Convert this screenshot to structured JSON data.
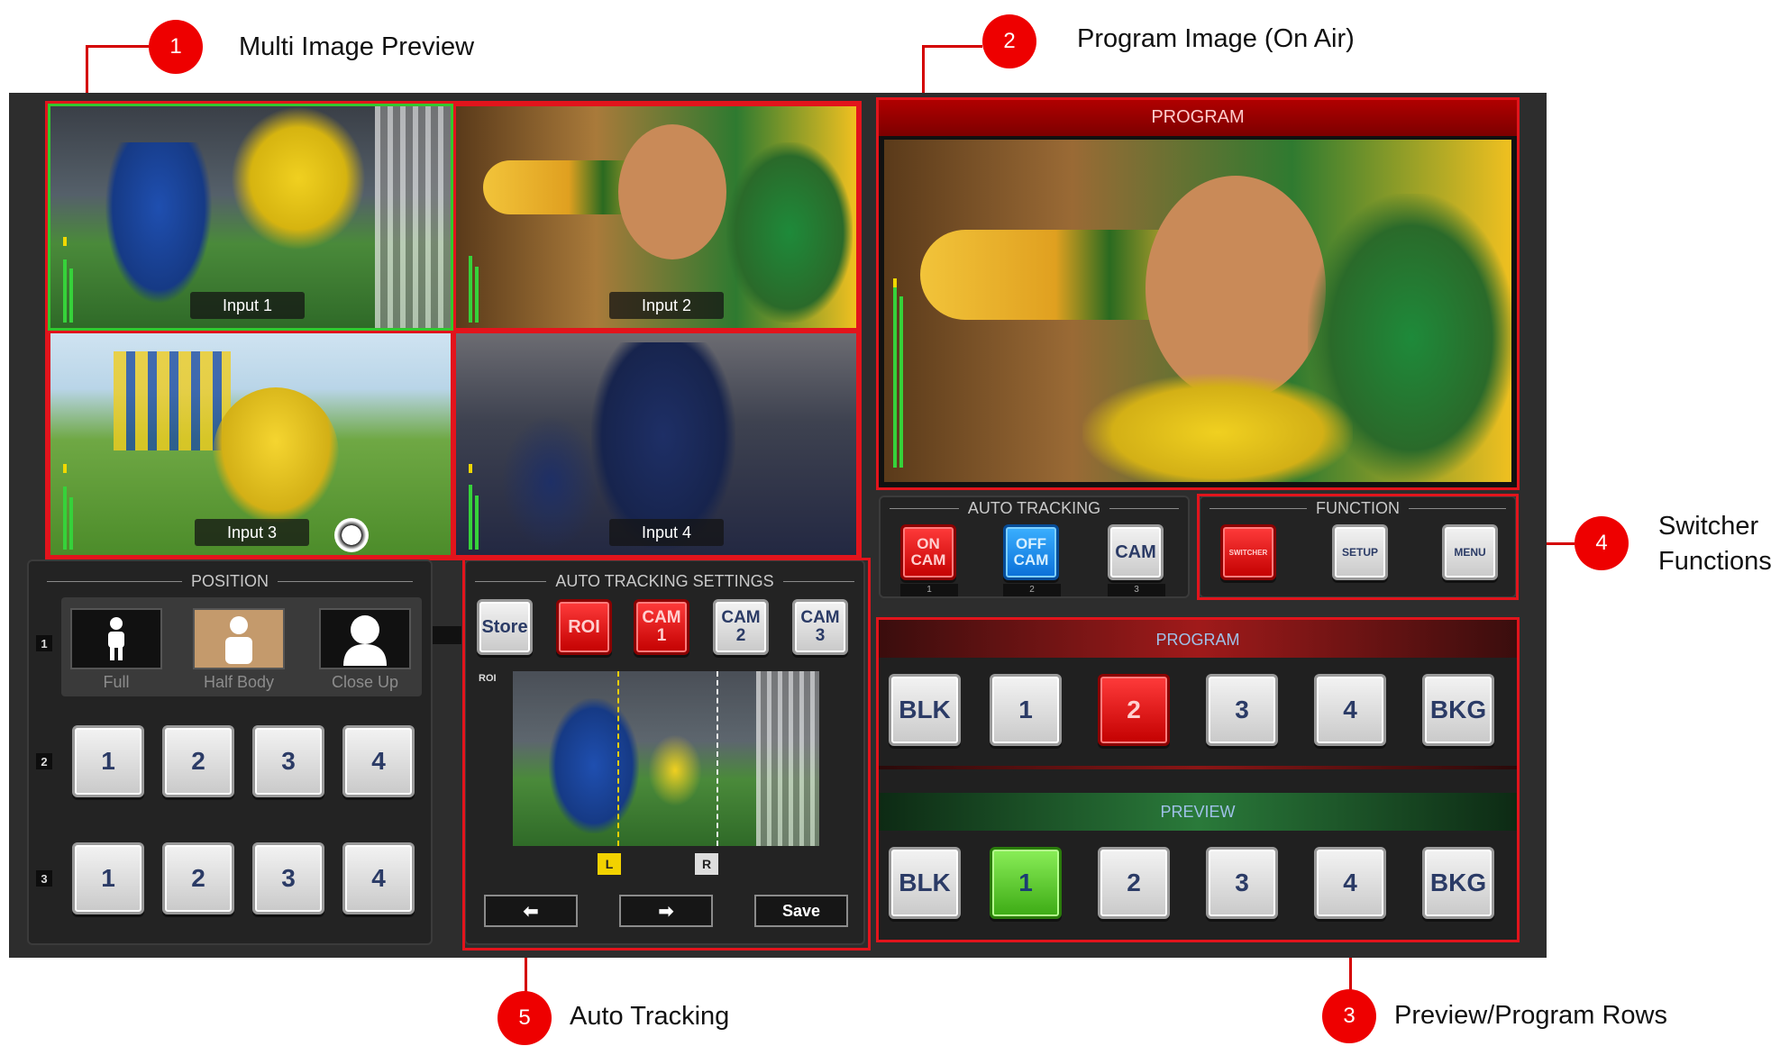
{
  "callouts": {
    "c1": {
      "number": "1",
      "label": "Multi Image Preview"
    },
    "c2": {
      "number": "2",
      "label": "Program Image (On Air)"
    },
    "c3": {
      "number": "3",
      "label": "Preview/Program Rows"
    },
    "c4": {
      "number": "4",
      "label_line1": "Switcher",
      "label_line2": "Functions"
    },
    "c5": {
      "number": "5",
      "label": "Auto Tracking"
    }
  },
  "multiview": {
    "inputs": [
      "Input 1",
      "Input 2",
      "Input 3",
      "Input 4"
    ]
  },
  "program_monitor": {
    "title": "PROGRAM"
  },
  "auto_tracking": {
    "title": "AUTO TRACKING",
    "buttons": [
      "ON CAM",
      "OFF CAM",
      "CAM"
    ],
    "tallies": [
      "1",
      "2",
      "3"
    ]
  },
  "function": {
    "title": "FUNCTION",
    "buttons": [
      "SWITCHER",
      "SETUP",
      "MENU"
    ]
  },
  "position": {
    "title": "POSITION",
    "rows": [
      "1",
      "2",
      "3"
    ],
    "presets": [
      "Full",
      "Half Body",
      "Close Up"
    ],
    "row2_keys": [
      "1",
      "2",
      "3",
      "4"
    ],
    "row3_keys": [
      "1",
      "2",
      "3",
      "4"
    ]
  },
  "auto_tracking_settings": {
    "title": "AUTO TRACKING SETTINGS",
    "buttons": [
      "Store",
      "ROI",
      "CAM 1",
      "CAM 2",
      "CAM 3"
    ],
    "roi_label": "ROI",
    "markers": [
      "L",
      "R"
    ],
    "left_arrow": "⬅",
    "right_arrow": "➡",
    "save": "Save"
  },
  "program_row": {
    "title": "PROGRAM",
    "keys": [
      "BLK",
      "1",
      "2",
      "3",
      "4",
      "BKG"
    ],
    "active": "2"
  },
  "preview_row": {
    "title": "PREVIEW",
    "keys": [
      "BLK",
      "1",
      "2",
      "3",
      "4",
      "BKG"
    ],
    "active": "1"
  },
  "colors": {
    "annotation_red": "#e2141c",
    "panel_bg": "#2d2d2d",
    "program_red": "#d40000",
    "preview_green": "#3caa14",
    "tracking_blue": "#0a6fd8"
  }
}
